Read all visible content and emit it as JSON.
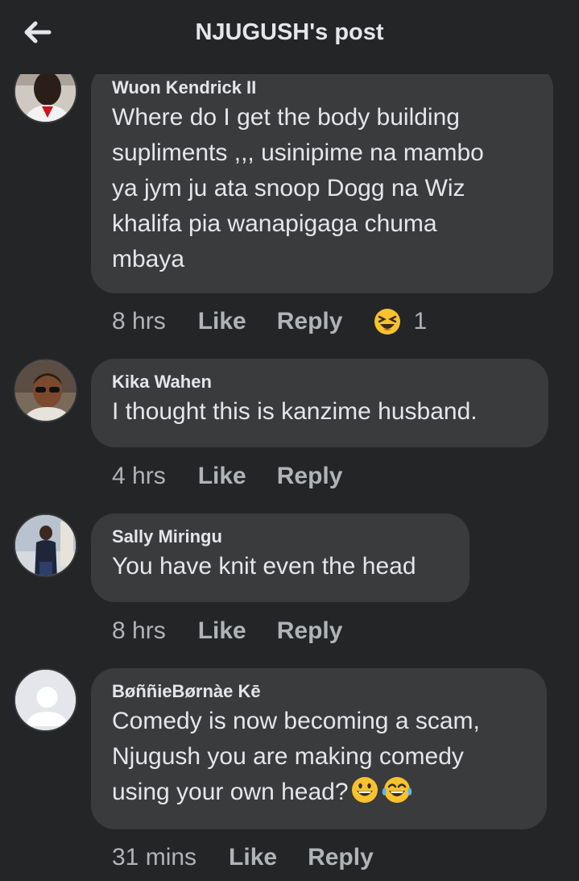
{
  "header": {
    "title": "NJUGUSH's post"
  },
  "comments": [
    {
      "author": "Wuon Kendrick II",
      "text_lines": [
        "Where do I get the body building",
        "supliments ,,, usinipime na mambo",
        "ya jym ju ata snoop Dogg na Wiz",
        "khalifa pia wanapigaga chuma",
        "mbaya"
      ],
      "time": "8 hrs",
      "like": "Like",
      "reply": "Reply",
      "reaction": {
        "icon": "laughing-squint-emoji",
        "count": "1"
      }
    },
    {
      "author": "Kika Wahen",
      "text_lines": [
        "I thought this is kanzime husband."
      ],
      "time": "4 hrs",
      "like": "Like",
      "reply": "Reply"
    },
    {
      "author": "Sally Miringu",
      "text_lines": [
        "You have knit even the head"
      ],
      "time": "8 hrs",
      "like": "Like",
      "reply": "Reply"
    },
    {
      "author": "BøññieBørnàe Kē",
      "text_lines": [
        "Comedy is now becoming a scam,",
        "Njugush you are making comedy",
        "using your own head?"
      ],
      "trailing_emojis": [
        "grinning-emoji",
        "tears-of-joy-emoji"
      ],
      "time": "31 mins",
      "like": "Like",
      "reply": "Reply"
    }
  ],
  "colors": {
    "background": "#242526",
    "bubble": "#3a3b3c",
    "text": "#e4e6eb",
    "secondary": "#b0b3b8",
    "emoji": "#f7c22e"
  }
}
